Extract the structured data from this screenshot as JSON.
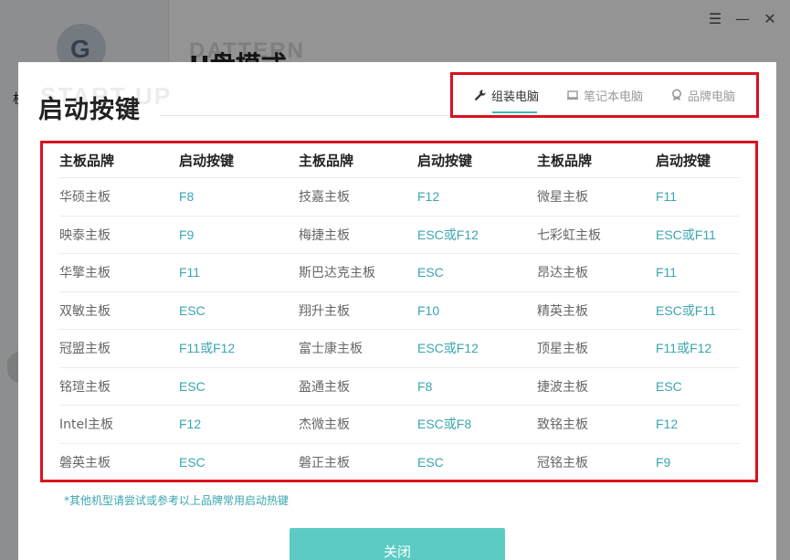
{
  "app": {
    "ghost_title_en": "DATTERN",
    "ghost_title_cn": "U盘模式",
    "sidebar_text": "机",
    "logo_glyph": "G",
    "window_controls": [
      {
        "icon": "menu-icon",
        "glyph": "☰"
      },
      {
        "icon": "minimize-icon",
        "glyph": "—"
      },
      {
        "icon": "close-icon",
        "glyph": "✕"
      }
    ]
  },
  "dialog": {
    "ghost_title": "START UP",
    "title": "启动按键",
    "tabs": [
      {
        "label": "组装电脑",
        "icon": "wrench-icon",
        "active": true
      },
      {
        "label": "笔记本电脑",
        "icon": "laptop-icon",
        "active": false
      },
      {
        "label": "品牌电脑",
        "icon": "badge-icon",
        "active": false
      }
    ],
    "table": {
      "headers": [
        "主板品牌",
        "启动按键",
        "主板品牌",
        "启动按键",
        "主板品牌",
        "启动按键"
      ],
      "rows": [
        [
          "华硕主板",
          "F8",
          "技嘉主板",
          "F12",
          "微星主板",
          "F11"
        ],
        [
          "映泰主板",
          "F9",
          "梅捷主板",
          "ESC或F12",
          "七彩虹主板",
          "ESC或F11"
        ],
        [
          "华擎主板",
          "F11",
          "斯巴达克主板",
          "ESC",
          "昂达主板",
          "F11"
        ],
        [
          "双敏主板",
          "ESC",
          "翔升主板",
          "F10",
          "精英主板",
          "ESC或F11"
        ],
        [
          "冠盟主板",
          "F11或F12",
          "富士康主板",
          "ESC或F12",
          "顶星主板",
          "F11或F12"
        ],
        [
          "铭瑄主板",
          "ESC",
          "盈通主板",
          "F8",
          "捷波主板",
          "ESC"
        ],
        [
          "Intel主板",
          "F12",
          "杰微主板",
          "ESC或F8",
          "致铭主板",
          "F12"
        ],
        [
          "磐英主板",
          "ESC",
          "磐正主板",
          "ESC",
          "冠铭主板",
          "F9"
        ]
      ]
    },
    "note": "*其他机型请尝试或参考以上品牌常用启动热键",
    "close_label": "关闭"
  },
  "colors": {
    "accent": "#3bb9b2",
    "key_text": "#3aa6b0",
    "close_button": "#5ccbc4",
    "highlight_box": "#d9121f"
  }
}
